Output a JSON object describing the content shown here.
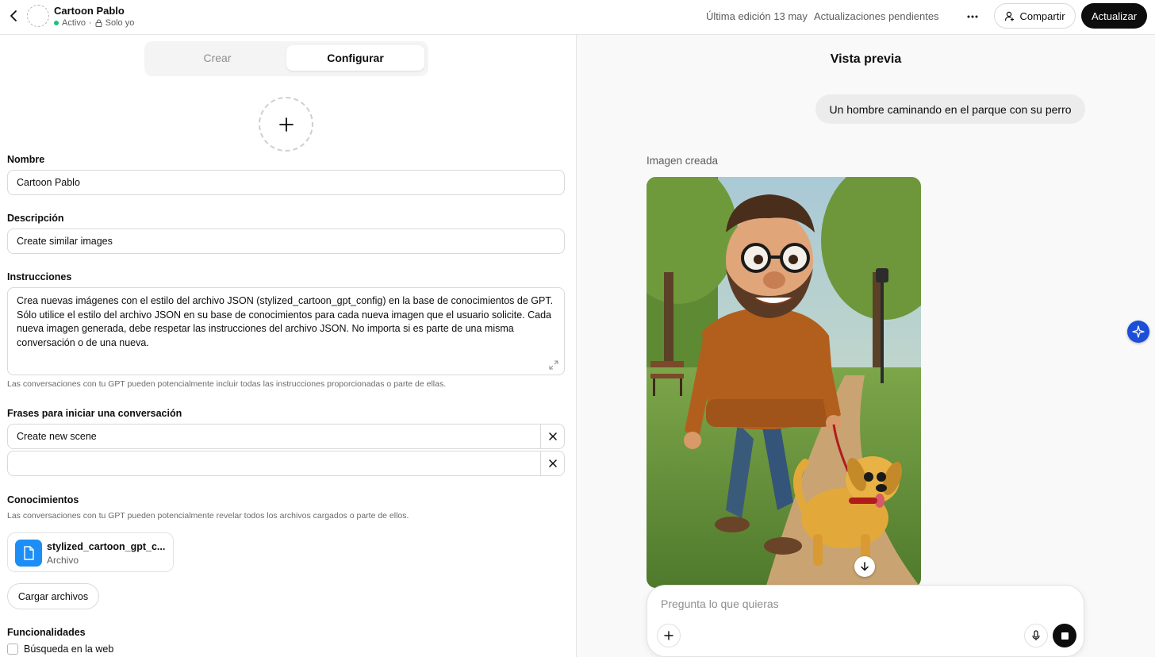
{
  "header": {
    "gpt_name": "Cartoon Pablo",
    "status": "Activo",
    "separator": "·",
    "visibility": "Solo yo",
    "last_edit": "Última edición 13 may",
    "pending": "Actualizaciones pendientes",
    "share_label": "Compartir",
    "update_label": "Actualizar"
  },
  "tabs": {
    "create": "Crear",
    "configure": "Configurar"
  },
  "form": {
    "name_label": "Nombre",
    "name_value": "Cartoon Pablo",
    "description_label": "Descripción",
    "description_value": "Create similar images",
    "instructions_label": "Instrucciones",
    "instructions_value": "Crea nuevas imágenes con el estilo del archivo JSON (stylized_cartoon_gpt_config) en la base de conocimientos de GPT. Sólo utilice el estilo del archivo JSON en su base de conocimientos para cada nueva imagen que el usuario solicite. Cada nueva imagen generada, debe respetar las instrucciones del archivo JSON. No importa si es parte de una misma conversación o de una nueva.",
    "instructions_hint": "Las conversaciones con tu GPT pueden potencialmente incluir todas las instrucciones proporcionadas o parte de ellas.",
    "starters_label": "Frases para iniciar una conversación",
    "starters": [
      "Create new scene",
      ""
    ],
    "knowledge_label": "Conocimientos",
    "knowledge_hint": "Las conversaciones con tu GPT pueden potencialmente revelar todos los archivos cargados o parte de ellos.",
    "file_name": "stylized_cartoon_gpt_c...",
    "file_type": "Archivo",
    "upload_label": "Cargar archivos",
    "capabilities_label": "Funcionalidades",
    "web_search_label": "Búsqueda en la web",
    "web_search_checked": false
  },
  "preview": {
    "title": "Vista previa",
    "user_message": "Un hombre caminando en el parque con su perro",
    "image_label": "Imagen creada",
    "composer_placeholder": "Pregunta lo que quieras"
  },
  "colors": {
    "accent_dark": "#0d0d0d",
    "file_icon_blue": "#1d8ef5",
    "status_green": "#19c37d",
    "sparkle_blue": "#1d4ed8"
  },
  "icons": [
    "back-arrow-icon",
    "lock-icon",
    "more-icon",
    "share-person-icon",
    "plus-icon",
    "expand-icon",
    "close-icon",
    "file-icon",
    "download-arrow-icon",
    "microphone-icon",
    "stop-icon",
    "sparkle-icon"
  ]
}
